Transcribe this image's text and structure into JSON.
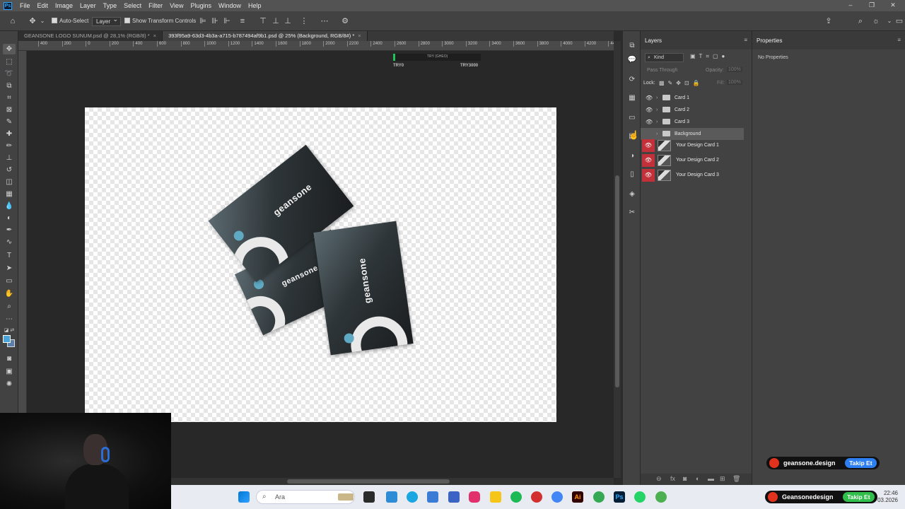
{
  "menubar": {
    "items": [
      "File",
      "Edit",
      "Image",
      "Layer",
      "Type",
      "Select",
      "Filter",
      "View",
      "Plugins",
      "Window",
      "Help"
    ],
    "window_controls": [
      "–",
      "❐",
      "✕"
    ]
  },
  "options": {
    "auto_select": "Auto-Select",
    "layer_dropdown": "Layer",
    "show_transform": "Show Transform Controls"
  },
  "tabs": [
    {
      "label": "GEANSONE LOGO SUNUM.psd @ 28,1% (RGB/8) *",
      "close": "×"
    },
    {
      "label": "393f95a9-63d3-4b3a-a715-b787494af9b1.psd @ 25% (Background, RGB/8#) *",
      "close": "×"
    }
  ],
  "rulers": {
    "h_ticks": [
      "400",
      "200",
      "0",
      "200",
      "400",
      "600",
      "800",
      "1000",
      "1200",
      "1400",
      "1600",
      "1800",
      "2000",
      "2200",
      "2400",
      "2600",
      "2800",
      "3000",
      "3200",
      "3400",
      "3600",
      "3800",
      "4000",
      "4200",
      "4400"
    ]
  },
  "canvas_info": {
    "left_label": "TRY0",
    "right_label": "TRY3000",
    "top_text": "TRY (GHEO)"
  },
  "cards": {
    "brand": "geansone"
  },
  "layers": {
    "panel_title": "Layers",
    "kind_label": "Kind",
    "blend": "Pass Through",
    "opacity_label": "Opacity:",
    "opacity_value": "100%",
    "lock_label": "Lock:",
    "fill_label": "Fill:",
    "fill_value": "100%",
    "groups": [
      {
        "name": "Card 1",
        "selected": false
      },
      {
        "name": "Card 2",
        "selected": false
      },
      {
        "name": "Card 3",
        "selected": false
      },
      {
        "name": "Background",
        "selected": true
      }
    ],
    "smart_objects": [
      {
        "name": "Your Design Card 1"
      },
      {
        "name": "Your Design Card 2"
      },
      {
        "name": "Your Design Card 3"
      }
    ]
  },
  "properties": {
    "panel_title": "Properties",
    "empty_text": "No Properties"
  },
  "taskbar": {
    "search_placeholder": "Ara",
    "time": "22:46",
    "date": "03.2026"
  },
  "social": [
    {
      "handle": "geansone.design",
      "follow": "Takip Et",
      "color": "#2d7ef0"
    },
    {
      "handle": "Geansonedesign",
      "follow": "Takip Et",
      "color": "#2fbf4a"
    }
  ]
}
